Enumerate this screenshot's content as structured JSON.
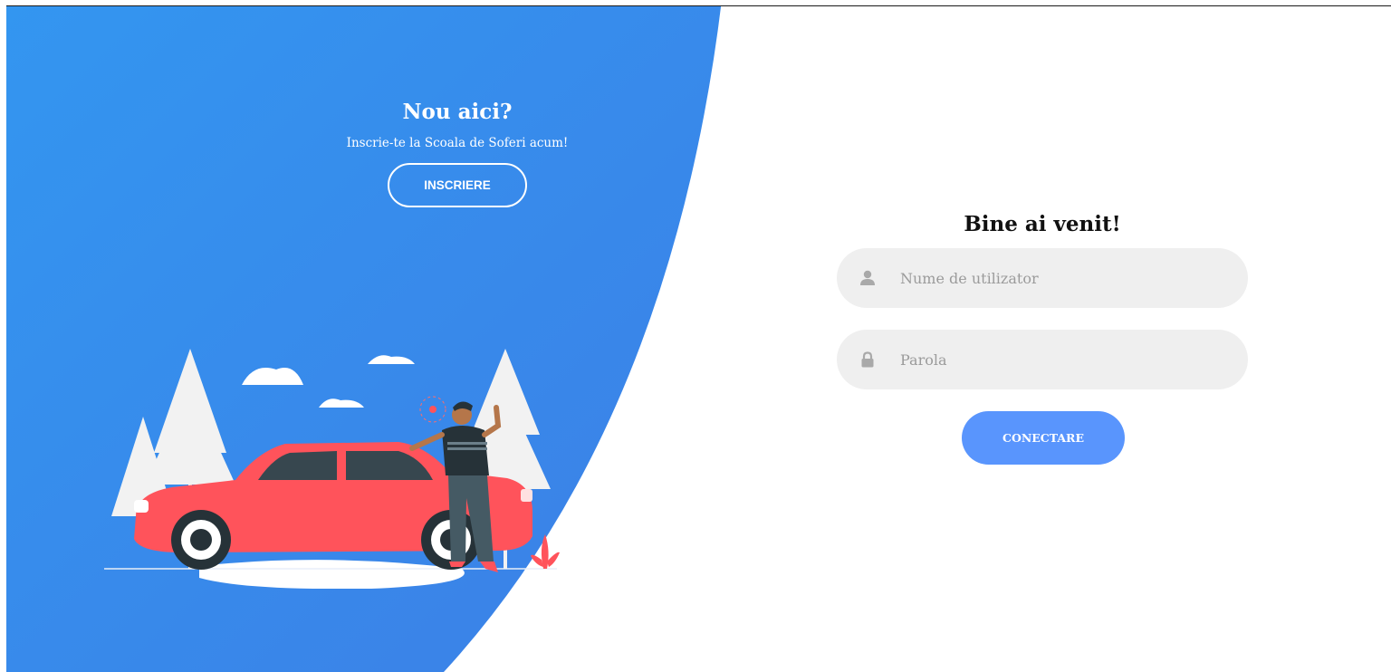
{
  "signup_panel": {
    "title": "Nou aici?",
    "subtitle": "Inscrie-te la Scoala de Soferi acum!",
    "button_label": "INSCRIERE"
  },
  "login_form": {
    "title": "Bine ai venit!",
    "username": {
      "placeholder": "Nume de utilizator",
      "value": "",
      "icon": "user-icon"
    },
    "password": {
      "placeholder": "Parola",
      "value": "",
      "icon": "lock-icon"
    },
    "submit_label": "CONECTARE"
  },
  "colors": {
    "panel_gradient_start": "#3396f0",
    "panel_gradient_end": "#3b82e8",
    "input_background": "#efefef",
    "login_button": "#5995fd",
    "car": "#ff535b"
  }
}
